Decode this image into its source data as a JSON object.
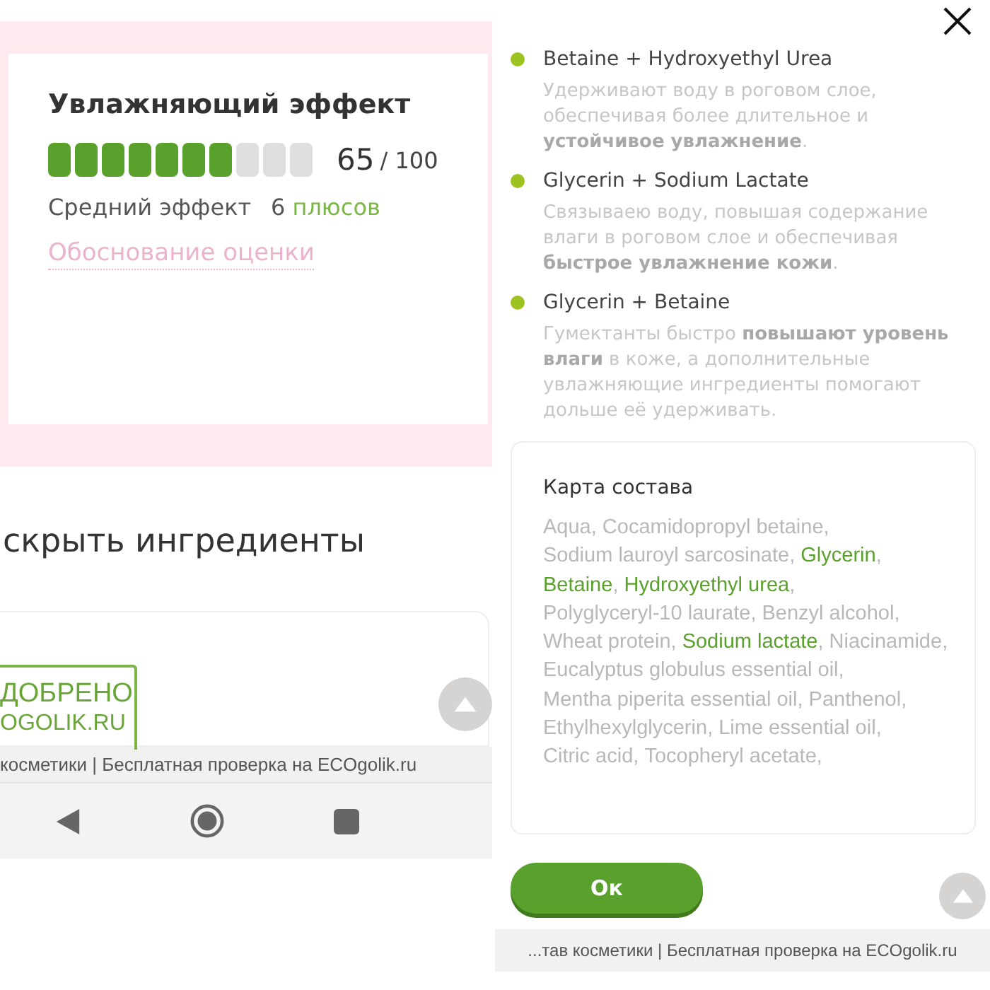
{
  "left_panel": {
    "score_card": {
      "title": "Увлажняющий эффект",
      "level": 0.65,
      "score": "65",
      "score_max": "/ 100",
      "verdict": "Средний эффект",
      "plus_count": "6",
      "plus_label": "плюсов",
      "link": "Обоснование оценки"
    },
    "section_heading": "скрыть ингредиенты",
    "stamp": {
      "line_1": "ДОБРЕНО",
      "line_2": "OGOLIK.RU"
    },
    "footer": "косметики | Бесплатная проверка на ECOgolik.ru"
  },
  "right_panel": {
    "benefits": [
      {
        "title": "Betaine + Hydroxyethyl Urea",
        "description": "Удерживают воду в роговом слое, обеспечивая более длительное и **устойчивое увлажнение**."
      },
      {
        "title": "Glycerin + Sodium Lactate",
        "description": "Связываею воду, повышая содержание влаги в роговом слое и обеспечивая **быстрое увлажнение кожи**."
      },
      {
        "title": "Glycerin + Betaine",
        "description": "Гумектанты быстро **повышают уровень влаги** в коже, а дополнительные увлажняющие ингредиенты помогают дольше её удерживать."
      }
    ],
    "composition": {
      "title": "Карта состава",
      "ingredients": [
        {
          "name": "Aqua",
          "separator": ",",
          "highlighted": false
        },
        {
          "name": "Cocamidopropyl betaine",
          "separator": ",",
          "highlighted": false
        },
        {
          "name": "Sodium lauroyl sarcosinate",
          "separator": ",",
          "highlighted": false
        },
        {
          "name": "Glycerin",
          "separator": ",",
          "highlighted": true
        },
        {
          "name": "Betaine",
          "separator": ",",
          "highlighted": true
        },
        {
          "name": "Hydroxyethyl urea",
          "separator": ",",
          "highlighted": true
        },
        {
          "name": "Polyglyceryl-10 laurate",
          "separator": ",",
          "highlighted": false
        },
        {
          "name": "Benzyl alcohol",
          "separator": ",",
          "highlighted": false
        },
        {
          "name": "Wheat protein",
          "separator": ",",
          "highlighted": false
        },
        {
          "name": "Sodium lactate",
          "separator": ",",
          "highlighted": true
        },
        {
          "name": "Niacinamide",
          "separator": ",",
          "highlighted": false
        },
        {
          "name": "Eucalyptus globulus essential oil",
          "separator": ",",
          "highlighted": false
        },
        {
          "name": "Mentha piperita essential oil",
          "separator": ",",
          "highlighted": false
        },
        {
          "name": "Panthenol",
          "separator": ",",
          "highlighted": false
        },
        {
          "name": "Ethylhexylglycerin",
          "separator": ",",
          "highlighted": false
        },
        {
          "name": "Lime essential oil",
          "separator": ",",
          "highlighted": false
        },
        {
          "name": "Citric acid",
          "separator": ",",
          "highlighted": false
        },
        {
          "name": "Tocopheryl acetate",
          "separator": ",",
          "highlighted": false
        }
      ]
    },
    "ok_button": "Ок",
    "footer": "...тав косметики | Бесплатная проверка на ECOgolik.ru"
  }
}
